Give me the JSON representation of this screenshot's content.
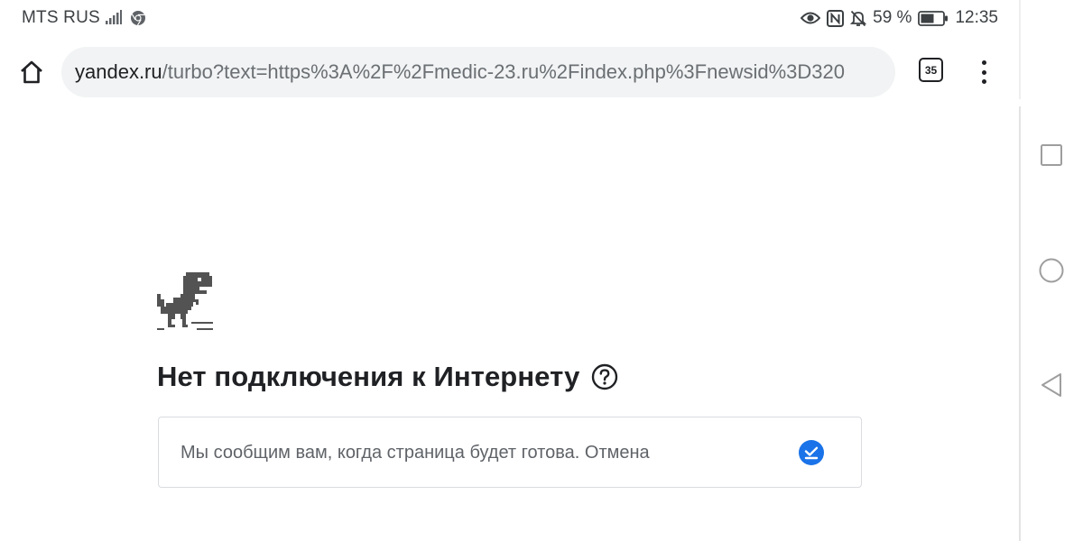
{
  "status_bar": {
    "carrier": "MTS RUS",
    "battery": "59 %",
    "time": "12:35",
    "icons": [
      "signal-icon",
      "chrome-icon",
      "eye-icon",
      "nfc-icon",
      "mute-icon",
      "battery-icon"
    ]
  },
  "toolbar": {
    "url_host": "yandex.ru",
    "url_path": "/turbo?text=https%3A%2F%2Fmedic-23.ru%2Findex.php%3Fnewsid%3D320",
    "tab_count": "35"
  },
  "page": {
    "heading": "Нет подключения к Интернету",
    "notice_text": "Мы сообщим вам, когда страница будет готова.",
    "cancel_label": "Отмена"
  },
  "nav": {
    "icons": [
      "recent-apps-icon",
      "home-circle-icon",
      "back-icon"
    ]
  },
  "colors": {
    "accent": "#1a73e8",
    "omnibox_bg": "#f1f3f4",
    "text": "#202124",
    "secondary_text": "#5f6368"
  }
}
